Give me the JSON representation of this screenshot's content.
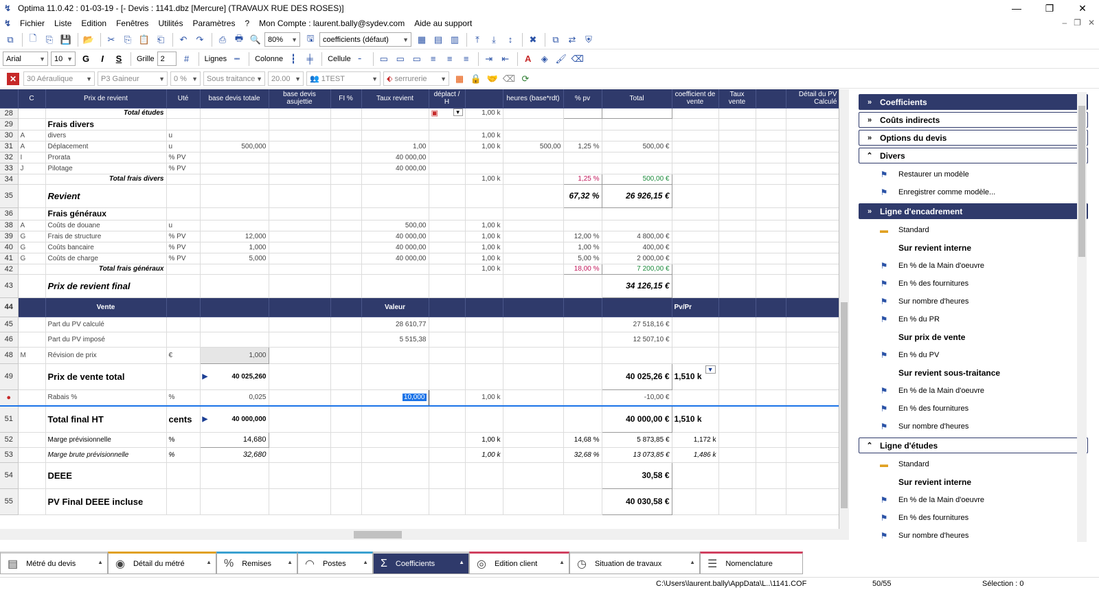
{
  "window": {
    "title": "Optima 11.0.42 : 01-03-19 - [- Devis : 1141.dbz [Mercure] (TRAVAUX RUE DES ROSES)]"
  },
  "menu": [
    "Fichier",
    "Liste",
    "Edition",
    "Fenêtres",
    "Utilités",
    "Paramètres",
    "?",
    "Mon Compte : laurent.bally@sydev.com",
    "Aide au support"
  ],
  "toolbar": {
    "zoom": "80%",
    "coef_select": "coefficients (défaut)",
    "font": "Arial",
    "font_size": "10",
    "bold": "G",
    "italic": "I",
    "strike": "S",
    "grid_label": "Grille",
    "grid_value": "2",
    "lines_label": "Lignes",
    "column_label": "Colonne",
    "cell_label": "Cellule",
    "aeraulique": "30 Aéraulique",
    "gaineur": "P3 Gaineur",
    "percent": "0 %",
    "soustraitance": "Sous traitance",
    "rate": "20.00",
    "test": "1TEST",
    "serrurerie": "serrurerie"
  },
  "grid": {
    "headers": [
      "C",
      "Prix de revient",
      "Uté",
      "base devis totale",
      "base devis asujettie",
      "FI %",
      "Taux revient",
      "déplact / H",
      "",
      "heures (base*rdt)",
      "% pv",
      "Total",
      "coefficient de vente",
      "Taux vente",
      "",
      "Détail du PV Calculé"
    ],
    "rows": [
      {
        "n": "28",
        "c": "",
        "label": "Total études",
        "u": "",
        "base": "",
        "taux": "",
        "dep": "",
        "k": "1,00 k",
        "h": "",
        "pv": "",
        "total": ""
      },
      {
        "n": "29",
        "c": "",
        "label": "Frais divers",
        "u": "",
        "base": "",
        "taux": "",
        "k": "",
        "h": "",
        "pv": "",
        "total": ""
      },
      {
        "n": "30",
        "c": "A",
        "label": "divers",
        "u": "u",
        "base": "",
        "taux": "",
        "k": "1,00 k",
        "h": "",
        "pv": "",
        "total": ""
      },
      {
        "n": "31",
        "c": "A",
        "label": "Déplacement",
        "u": "u",
        "base": "500,000",
        "taux": "1,00",
        "k": "1,00 k",
        "h": "500,00",
        "pv": "1,25 %",
        "total": "500,00 €"
      },
      {
        "n": "32",
        "c": "I",
        "label": "Prorata",
        "u": "% PV",
        "base": "",
        "taux": "40 000,00",
        "k": "",
        "h": "",
        "pv": "",
        "total": ""
      },
      {
        "n": "33",
        "c": "J",
        "label": "Pilotage",
        "u": "% PV",
        "base": "",
        "taux": "40 000,00",
        "k": "",
        "h": "",
        "pv": "",
        "total": ""
      },
      {
        "n": "34",
        "c": "",
        "label": "Total frais divers",
        "u": "",
        "base": "",
        "taux": "",
        "k": "1,00 k",
        "h": "",
        "pv": "1,25 %",
        "total": "500,00 €"
      },
      {
        "n": "35",
        "label": "Revient",
        "pv": "67,32 %",
        "total": "26 926,15 €"
      },
      {
        "n": "36",
        "label": "Frais généraux"
      },
      {
        "n": "38",
        "c": "A",
        "label": "Coûts de douane",
        "u": "u",
        "base": "",
        "taux": "500,00",
        "k": "1,00 k",
        "pv": "",
        "total": ""
      },
      {
        "n": "39",
        "c": "G",
        "label": "Frais de structure",
        "u": "% PV",
        "base": "12,000",
        "taux": "40 000,00",
        "k": "1,00 k",
        "pv": "12,00 %",
        "total": "4 800,00 €"
      },
      {
        "n": "40",
        "c": "G",
        "label": "Coûts bancaire",
        "u": "% PV",
        "base": "1,000",
        "taux": "40 000,00",
        "k": "1,00 k",
        "pv": "1,00 %",
        "total": "400,00 €"
      },
      {
        "n": "41",
        "c": "G",
        "label": "Coûts de charge",
        "u": "% PV",
        "base": "5,000",
        "taux": "40 000,00",
        "k": "1,00 k",
        "pv": "5,00 %",
        "total": "2 000,00 €"
      },
      {
        "n": "42",
        "label": "Total frais généraux",
        "k": "1,00 k",
        "pv": "18,00 %",
        "total": "7 200,00 €"
      },
      {
        "n": "43",
        "label": "Prix de revient final",
        "total": "34 126,15 €"
      },
      {
        "n": "44",
        "vente": "Vente",
        "valeur": "Valeur",
        "pvpr": "Pv/Pr"
      },
      {
        "n": "45",
        "label": "Part du PV calculé",
        "valeur": "28 610,77",
        "total": "27 518,16 €"
      },
      {
        "n": "46",
        "label": "Part du PV imposé",
        "valeur": "5 515,38",
        "total": "12 507,10 €"
      },
      {
        "n": "48",
        "c": "M",
        "label": "Révision de prix",
        "u": "€",
        "base": "1,000"
      },
      {
        "n": "49",
        "label": "Prix de vente total",
        "base": "40 025,260",
        "total": "40 025,26 €",
        "coef": "1,510 k"
      },
      {
        "n": "50",
        "label": "Rabais %",
        "u": "%",
        "base": "0,025",
        "valeur": "10,000",
        "k": "1,00 k",
        "total": "-10,00 €"
      },
      {
        "n": "51",
        "label": "Total final HT",
        "u": "cents",
        "base": "40 000,000",
        "total": "40 000,00 €",
        "coef": "1,510 k"
      },
      {
        "n": "52",
        "label": "Marge prévisionnelle",
        "u": "%",
        "base": "14,680",
        "k": "1,00 k",
        "pv": "14,68 %",
        "total": "5 873,85 €",
        "coef": "1,172 k"
      },
      {
        "n": "53",
        "label": "Marge brute prévisionnelle",
        "u": "%",
        "base": "32,680",
        "k": "1,00 k",
        "pv": "32,68 %",
        "total": "13 073,85 €",
        "coef": "1,486 k"
      },
      {
        "n": "54",
        "label": "DEEE",
        "total": "30,58 €"
      },
      {
        "n": "55",
        "label": "PV Final DEEE incluse",
        "total": "40 030,58 €"
      }
    ]
  },
  "panel": {
    "items": [
      {
        "type": "header-dark",
        "label": "Coefficients"
      },
      {
        "type": "header-light",
        "label": "Coûts indirects"
      },
      {
        "type": "header-light",
        "label": "Options du devis"
      },
      {
        "type": "header-light",
        "label": "Divers"
      },
      {
        "type": "item",
        "label": "Restaurer un modèle"
      },
      {
        "type": "item",
        "label": "Enregistrer comme modèle..."
      },
      {
        "type": "header-dark",
        "label": "Ligne d'encadrement"
      },
      {
        "type": "item",
        "label": "Standard"
      },
      {
        "type": "sub",
        "label": "Sur revient interne"
      },
      {
        "type": "item",
        "label": "En % de la Main d'oeuvre"
      },
      {
        "type": "item",
        "label": "En % des fournitures"
      },
      {
        "type": "item",
        "label": "Sur nombre d'heures"
      },
      {
        "type": "item",
        "label": "En % du PR"
      },
      {
        "type": "sub",
        "label": "Sur prix de vente"
      },
      {
        "type": "item",
        "label": "En % du PV"
      },
      {
        "type": "sub",
        "label": "Sur revient sous-traitance"
      },
      {
        "type": "item",
        "label": "En % de la Main d'oeuvre"
      },
      {
        "type": "item",
        "label": "En % des fournitures"
      },
      {
        "type": "item",
        "label": "Sur nombre d'heures"
      },
      {
        "type": "header-light",
        "label": "Ligne d'études"
      },
      {
        "type": "item",
        "label": "Standard"
      },
      {
        "type": "sub",
        "label": "Sur revient interne"
      },
      {
        "type": "item",
        "label": "En % de la Main d'oeuvre"
      },
      {
        "type": "item",
        "label": "En % des fournitures"
      },
      {
        "type": "item",
        "label": "Sur nombre d'heures"
      }
    ]
  },
  "tabs": [
    "Métré du devis",
    "Détail du métré",
    "Remises",
    "Postes",
    "Coefficients",
    "Edition client",
    "Situation de travaux",
    "Nomenclature"
  ],
  "status": {
    "path": "C:\\Users\\laurent.bally\\AppData\\L..\\1141.COF",
    "position": "50/55",
    "selection": "Sélection : 0"
  }
}
